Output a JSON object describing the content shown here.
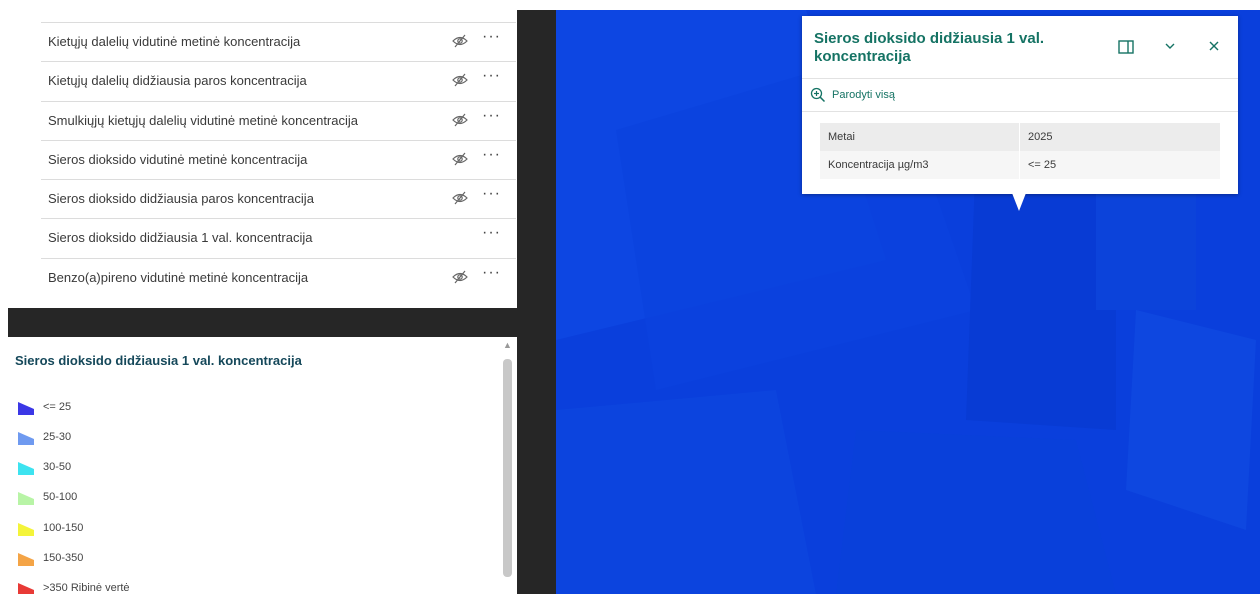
{
  "layers": {
    "items": [
      {
        "label": "Kietųjų dalelių vidutinė metinė koncentracija",
        "hidden_icon": "eye-off-icon",
        "more": "···"
      },
      {
        "label": "Kietųjų dalelių didžiausia paros koncentracija",
        "hidden_icon": "eye-off-icon",
        "more": "···"
      },
      {
        "label": "Smulkiųjų kietųjų dalelių vidutinė metinė koncentracija",
        "hidden_icon": "eye-off-icon",
        "more": "···"
      },
      {
        "label": "Sieros dioksido vidutinė metinė koncentracija",
        "hidden_icon": "eye-off-icon",
        "more": "···"
      },
      {
        "label": "Sieros dioksido didžiausia paros koncentracija",
        "hidden_icon": "eye-off-icon",
        "more": "···"
      },
      {
        "label": "Sieros dioksido didžiausia 1 val. koncentracija",
        "hidden_icon": "",
        "more": "···"
      },
      {
        "label": "Benzo(a)pireno vidutinė metinė koncentracija",
        "hidden_icon": "eye-off-icon",
        "more": "···"
      }
    ]
  },
  "legend": {
    "title": "Sieros dioksido didžiausia 1 val. koncentracija",
    "items": [
      {
        "label": "<= 25",
        "color": "#3b37e6"
      },
      {
        "label": "25-30",
        "color": "#6f9af0"
      },
      {
        "label": "30-50",
        "color": "#3de3f0"
      },
      {
        "label": "50-100",
        "color": "#b8f4a6"
      },
      {
        "label": "100-150",
        "color": "#f4f43a"
      },
      {
        "label": "150-350",
        "color": "#f4a446"
      },
      {
        "label": ">350 Ribinė vertė",
        "color": "#e83a36"
      }
    ]
  },
  "popup": {
    "title": "Sieros dioksido didžiausia 1 val. koncentracija",
    "zoom_label": "Parodyti visą",
    "rows": [
      {
        "key": "Metai",
        "value": "2025"
      },
      {
        "key": "Koncentracija µg/m3",
        "value": "<= 25"
      }
    ],
    "accent_color": "#157364"
  },
  "map": {
    "fill_color": "#0a3fdc"
  }
}
